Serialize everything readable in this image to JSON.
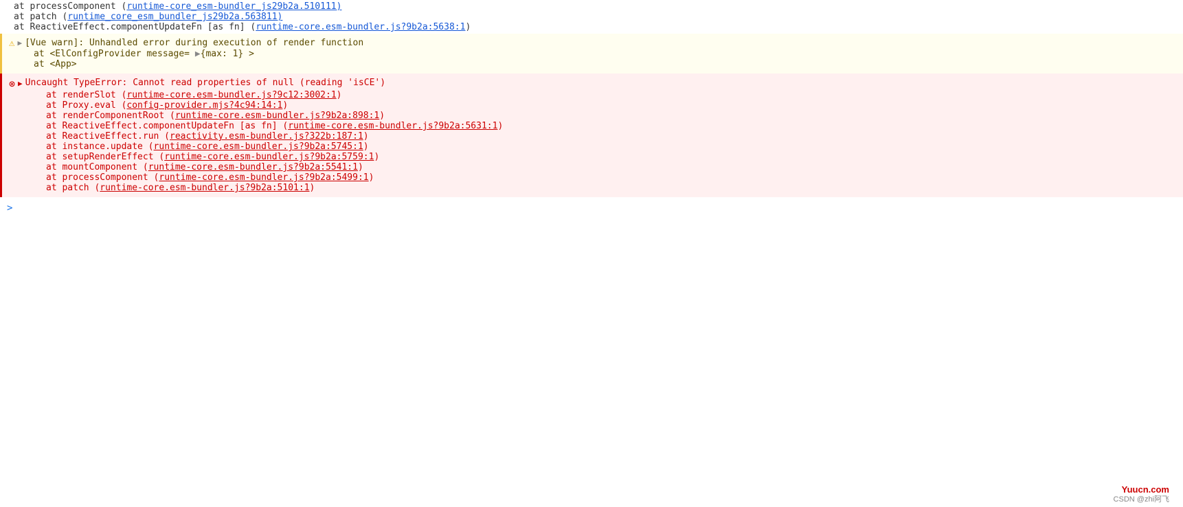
{
  "console": {
    "top_lines": [
      {
        "text": "    at processComponent (",
        "link_text": "runtime-core_esm-bundler_js29b2a.510111)",
        "link_href": "runtime-core_esm-bundler_js29b2a.5101:1"
      },
      {
        "text": "    at patch (",
        "link_text": "runtime-core_esm-bundler_js29b2a.563811)",
        "link_href": "runtime-core_esm-bundler_js29b2a.5638:1"
      },
      {
        "text": "    at ReactiveEffect.componentUpdateFn [as fn] (",
        "link_text": "runtime-core.esm-bundler.js?9b2a:5638:1",
        "link_href": "runtime-core.esm-bundler.js?9b2a:5638:1"
      }
    ],
    "warning_block": {
      "icon": "⚠",
      "triangle": "▶",
      "main_text": "[Vue warn]: Unhandled error during execution of render function",
      "lines": [
        "    at <ElConfigProvider message= ▶{max: 1} >",
        "    at <App>"
      ]
    },
    "error_block": {
      "icon": "⊗",
      "triangle": "▶",
      "main_text": "Uncaught TypeError: Cannot read properties of null (reading 'isCE')",
      "stack_lines": [
        {
          "prefix": "        at renderSlot (",
          "link_text": "runtime-core.esm-bundler.js?9c12:3002:1",
          "link_href": "runtime-core.esm-bundler.js?9c12:3002:1",
          "suffix": ")"
        },
        {
          "prefix": "        at Proxy.eval (",
          "link_text": "config-provider.mjs?4c94:14:1",
          "link_href": "config-provider.mjs?4c94:14:1",
          "suffix": ")"
        },
        {
          "prefix": "        at renderComponentRoot (",
          "link_text": "runtime-core.esm-bundler.js?9b2a:898:1",
          "link_href": "runtime-core.esm-bundler.js?9b2a:898:1",
          "suffix": ")"
        },
        {
          "prefix": "        at ReactiveEffect.componentUpdateFn [as fn] (",
          "link_text": "runtime-core.esm-bundler.js?9b2a:5631:1",
          "link_href": "runtime-core.esm-bundler.js?9b2a:5631:1",
          "suffix": ")"
        },
        {
          "prefix": "        at ReactiveEffect.run (",
          "link_text": "reactivity.esm-bundler.js?322b:187:1",
          "link_href": "reactivity.esm-bundler.js?322b:187:1",
          "suffix": ")"
        },
        {
          "prefix": "        at instance.update (",
          "link_text": "runtime-core.esm-bundler.js?9b2a:5745:1",
          "link_href": "runtime-core.esm-bundler.js?9b2a:5745:1",
          "suffix": ")"
        },
        {
          "prefix": "        at setupRenderEffect (",
          "link_text": "runtime-core.esm-bundler.js?9b2a:5759:1",
          "link_href": "runtime-core.esm-bundler.js?9b2a:5759:1",
          "suffix": ")"
        },
        {
          "prefix": "        at mountComponent (",
          "link_text": "runtime-core.esm-bundler.js?9b2a:5541:1",
          "link_href": "runtime-core.esm-bundler.js?9b2a:5541:1",
          "suffix": ")"
        },
        {
          "prefix": "        at processComponent (",
          "link_text": "runtime-core.esm-bundler.js?9b2a:5499:1",
          "link_href": "runtime-core.esm-bundler.js?9b2a:5499:1",
          "suffix": ")"
        },
        {
          "prefix": "        at patch (",
          "link_text": "runtime-core.esm-bundler.js?9b2a:5101:1",
          "link_href": "runtime-core.esm-bundler.js?9b2a:5101:1",
          "suffix": ")"
        }
      ]
    },
    "input_prompt": ">",
    "watermark": "Yuucn.com",
    "csdn_credit": "CSDN @zhi阿飞"
  }
}
